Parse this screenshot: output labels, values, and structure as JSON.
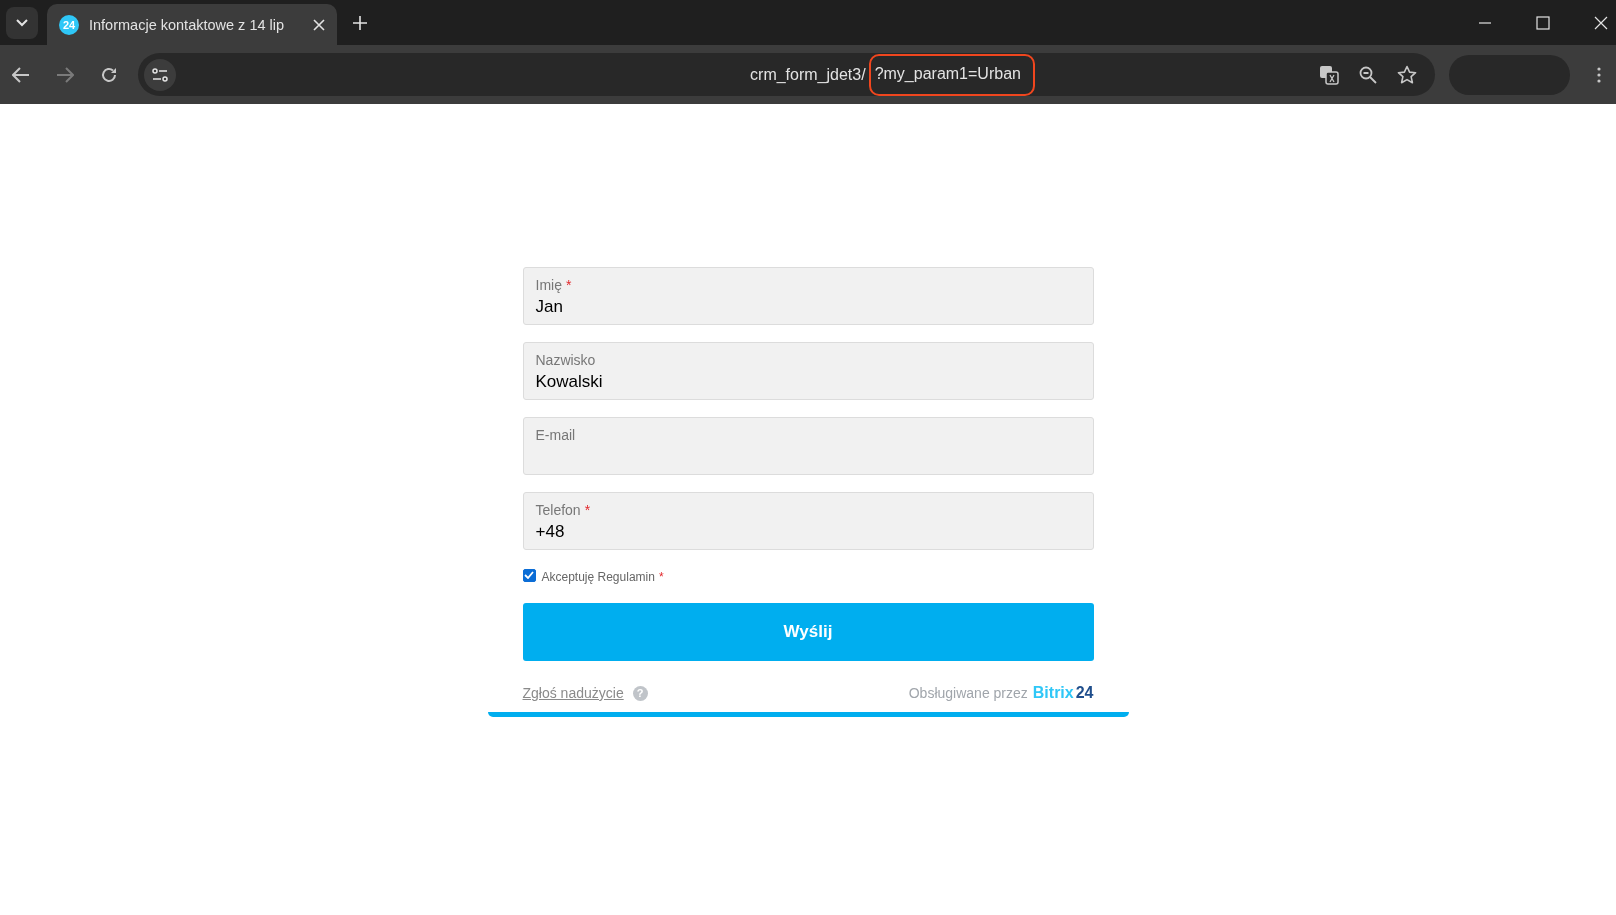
{
  "browser": {
    "tab": {
      "favicon": "24",
      "title": "Informacje kontaktowe z 14 lip",
      "selected": true
    },
    "address": {
      "url": "crm_form_jdet3/",
      "highlighted": "?my_param1=Urban"
    }
  },
  "form": {
    "fields": [
      {
        "label": "Imię",
        "value": "Jan",
        "required_mark": "*"
      },
      {
        "label": "Nazwisko",
        "value": "Kowalski"
      },
      {
        "label": "E-mail"
      },
      {
        "label": "Telefon",
        "value": "+48",
        "required_mark": "*"
      }
    ],
    "consent": {
      "label": "Akceptuję Regulamin",
      "checked": true,
      "required_mark": "*"
    },
    "submit": "Wyślij",
    "footer": {
      "report_link": "Zgłoś nadużycie",
      "help": "?",
      "powered_by": "Obsługiwane przez",
      "logo_word": "Bitrix",
      "logo_number": "24"
    }
  }
}
